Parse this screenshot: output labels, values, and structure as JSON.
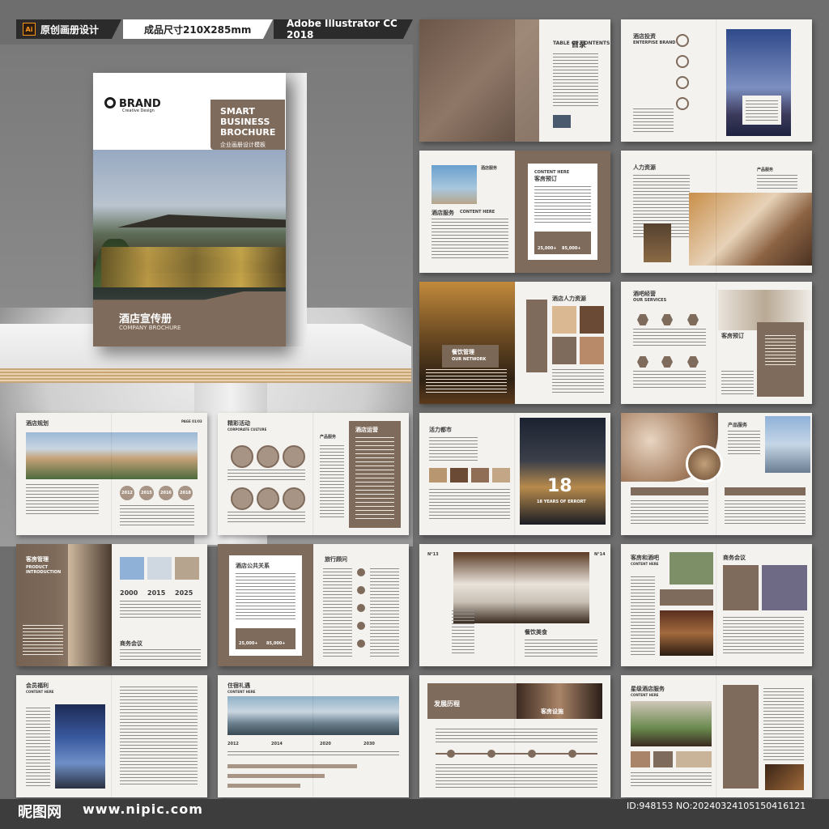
{
  "header": {
    "software_badge": "Ai",
    "tag1": "原创画册设计",
    "tag2": "成品尺寸210X285mm",
    "tag3": "Adobe Illustrator CC 2018"
  },
  "cover": {
    "logo": "BRAND",
    "logo_sub": "Creative Design",
    "title_en_1": "SMART",
    "title_en_2": "BUSINESS",
    "title_en_3": "BROCHURE",
    "subtitle_cn": "企业画册设计模板",
    "title_cn": "酒店宣传册",
    "title_en": "COMPANY BROCHURE"
  },
  "pages": {
    "toc": "目录",
    "toc_en": "TABLE OF CONTENTS",
    "invest": "酒店投资",
    "invest_en": "ENTERPISE BRAND",
    "service": "酒店服务",
    "content_here": "CONTENT HERE",
    "booking": "客房预订",
    "hr": "人力资源",
    "product_service": "产品服务",
    "hr_hotel": "酒店人力资源",
    "dining": "餐饮管理",
    "network": "OUR NETWORK",
    "bar": "酒吧经营",
    "our_services": "OUR SERVICES",
    "plan": "酒店规划",
    "page_no": "PAGE 01/03",
    "years": [
      "2012",
      "2015",
      "2016",
      "2018"
    ],
    "events": "精彩活动",
    "corp_culture": "CORPORATE CULTURE",
    "operation": "酒店运营",
    "vitality": "活力都市",
    "big_number": "18",
    "years_label": "18 YEARS OF ERRORT",
    "product_service2": "产品服务",
    "guest": "客房管理",
    "product_intro": "PRODUCT INTRODUCTION",
    "years2": [
      "2000",
      "2015",
      "2025"
    ],
    "meeting": "商务会议",
    "pr": "酒店公共关系",
    "travel": "旅行顾问",
    "n13": "N°13",
    "n14": "N°14",
    "catering": "餐饮美食",
    "mall": "客房和酒吧",
    "biz_meeting": "商务会议",
    "member": "会员福利",
    "residence": "住宿礼遇",
    "years3": [
      "2012",
      "2014",
      "2020",
      "2030"
    ],
    "history": "发展历程",
    "guest_mgmt": "客房设施",
    "star_service": "星级酒店服务",
    "num1": "25,000+",
    "num2": "85,000+"
  },
  "footer": {
    "site_cn": "昵图网",
    "site_url": "www.nipic.com",
    "id_text": "ID:948153 NO:20240324105150416121"
  }
}
